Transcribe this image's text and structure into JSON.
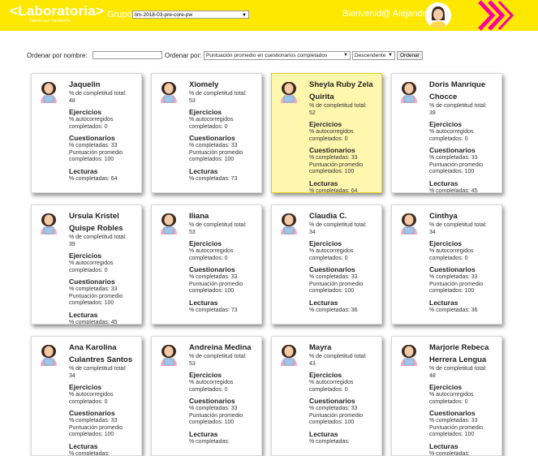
{
  "header": {
    "logo": "<Laboratoria>",
    "tagline": "Talento que transforma",
    "grupo_label": "Grupo",
    "grupo_value": "lim-2018-03-pre-core-pw",
    "welcome": "Bienvenid@ Alejandra",
    "colors": {
      "bar": "#ffe800",
      "accent": "#ff009e"
    }
  },
  "filters": {
    "name_label": "Ordenar por nombre:",
    "name_value": "",
    "by_label": "Ordenar por:",
    "by_value": "Puntuación promedio en cuestionarios completados",
    "dir_value": "Descendente",
    "button": "Ordenar"
  },
  "labels": {
    "completitud": "% de completitud total:",
    "ejercicios": "Ejercicios",
    "autocorregidos": "% autocorregidos completados:",
    "cuestionarios": "Cuestionarios",
    "completadas": "% completadas:",
    "puntuacion": "Puntuación promedio completados:",
    "lecturas": "Lecturas"
  },
  "students": [
    {
      "name": "Jaquelin",
      "total": "48",
      "ejercicios": "0",
      "cuestionarios": "33",
      "puntuacion": "100",
      "lecturas": "64"
    },
    {
      "name": "Xiomely",
      "total": "53",
      "ejercicios": "0",
      "cuestionarios": "33",
      "puntuacion": "100",
      "lecturas": "73"
    },
    {
      "name": "Sheyla Ruby Zela Quirita",
      "total": "52",
      "ejercicios": "0",
      "cuestionarios": "33",
      "puntuacion": "100",
      "lecturas": "64",
      "highlight": true
    },
    {
      "name": "Doris Manrique Chocce",
      "total": "39",
      "ejercicios": "0",
      "cuestionarios": "33",
      "puntuacion": "100",
      "lecturas": "45"
    },
    {
      "name": "Ursula Kristel Quispe Robles",
      "total": "39",
      "ejercicios": "0",
      "cuestionarios": "33",
      "puntuacion": "100",
      "lecturas": "45"
    },
    {
      "name": "Iliana",
      "total": "53",
      "ejercicios": "0",
      "cuestionarios": "33",
      "puntuacion": "100",
      "lecturas": "73"
    },
    {
      "name": "Claudia C.",
      "total": "34",
      "ejercicios": "0",
      "cuestionarios": "33",
      "puntuacion": "100",
      "lecturas": "36"
    },
    {
      "name": "Cinthya",
      "total": "34",
      "ejercicios": "0",
      "cuestionarios": "33",
      "puntuacion": "100",
      "lecturas": "36"
    },
    {
      "name": "Ana Karolina Culantres Santos",
      "total": "34",
      "ejercicios": "0",
      "cuestionarios": "33",
      "puntuacion": "100",
      "lecturas": ""
    },
    {
      "name": "Andreina Medina",
      "total": "53",
      "ejercicios": "0",
      "cuestionarios": "33",
      "puntuacion": "100",
      "lecturas": ""
    },
    {
      "name": "Mayra",
      "total": "43",
      "ejercicios": "0",
      "cuestionarios": "33",
      "puntuacion": "100",
      "lecturas": ""
    },
    {
      "name": "Marjorie Rebeca Herrera Lengua",
      "total": "48",
      "ejercicios": "0",
      "cuestionarios": "33",
      "puntuacion": "100",
      "lecturas": ""
    }
  ]
}
